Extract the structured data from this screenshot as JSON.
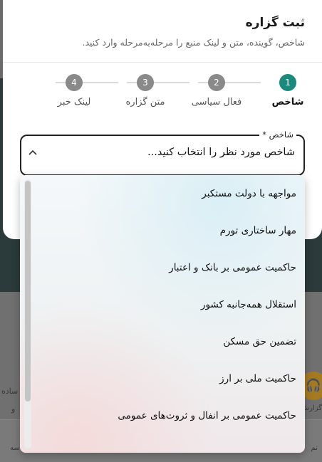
{
  "background": {
    "left_text_1": "ساده",
    "left_text_2": "و",
    "right_text": "گزارش",
    "nav_left": "سه",
    "nav_right": "نم"
  },
  "modal": {
    "title": "ثبت گزاره",
    "subtitle": "شاخص، گوینده، متن و لینک منبع را مرحله‌به‌مرحله وارد کنید."
  },
  "steps": [
    {
      "number": "1",
      "label": "شاخص"
    },
    {
      "number": "2",
      "label": "فعال سیاسی"
    },
    {
      "number": "3",
      "label": "متن گزاره"
    },
    {
      "number": "4",
      "label": "لینک خبر"
    }
  ],
  "field": {
    "label": "شاخص *",
    "value": "شاخص مورد نظر را انتخاب کنید..."
  },
  "options": [
    "مواجهه با دولت مستکبر",
    "مهار ساختاری تورم",
    "حاکمیت عمومی بر بانک و اعتبار",
    "استقلال همه‌جانبه کشور",
    "تضمین حق مسکن",
    "حاکمیت ملی بر ارز",
    "حاکمیت عمومی بر انفال و ثروت‌های عمومی"
  ],
  "colors": {
    "accent": "#1b8a7c",
    "inactive_step": "#8a8a8a"
  }
}
